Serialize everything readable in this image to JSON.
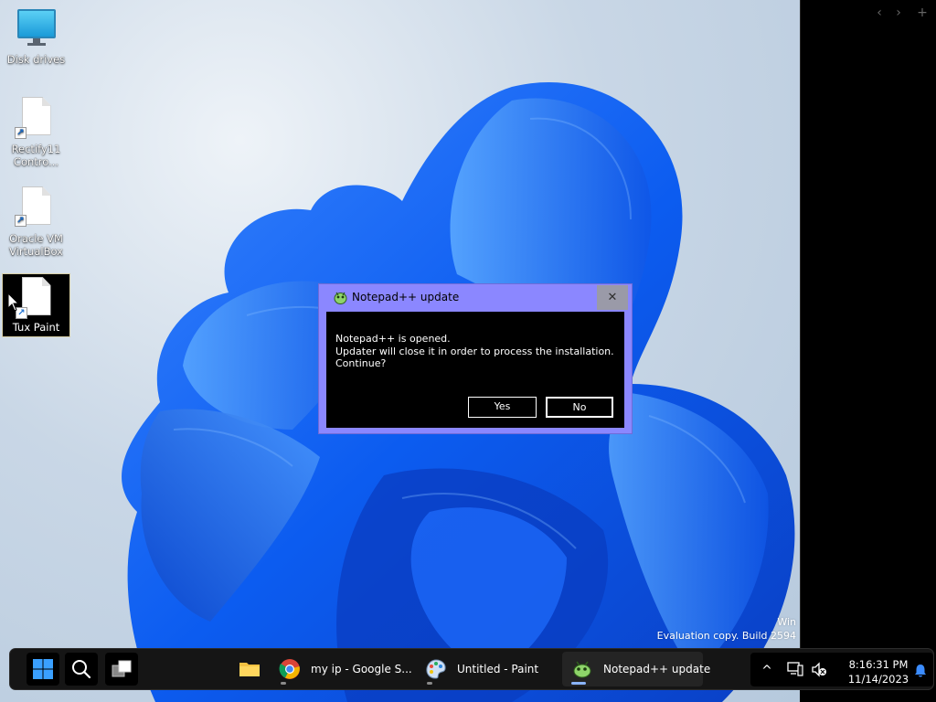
{
  "desktop": {
    "icons": [
      {
        "label": "Disk drives"
      },
      {
        "label": "Rectify11\nContro..."
      },
      {
        "label": "Oracle VM\nVirtualBox"
      },
      {
        "label": "Tux Paint"
      }
    ],
    "watermark": {
      "line1": "Win",
      "line2": "Evaluation copy. Build 2594"
    }
  },
  "side_panel": {
    "back": "‹",
    "forward": "›",
    "add": "+"
  },
  "dialog": {
    "title": "Notepad++ update",
    "close": "✕",
    "message": "Notepad++ is opened.\nUpdater will close it in order to process the installation.\nContinue?",
    "yes_label": "Yes",
    "no_label": "No"
  },
  "taskbar": {
    "apps": [
      {
        "label": ""
      },
      {
        "label": "my ip - Google S..."
      },
      {
        "label": "Untitled - Paint"
      },
      {
        "label": "Notepad++ update"
      }
    ],
    "tray": {
      "chevron": "^",
      "time": "8:16:31 PM",
      "date": "11/14/2023"
    }
  },
  "colors": {
    "dialog_frame": "#8b87ff",
    "dialog_body": "#000000",
    "taskbar": "#151515",
    "accent_blue": "#1a6fe8"
  }
}
